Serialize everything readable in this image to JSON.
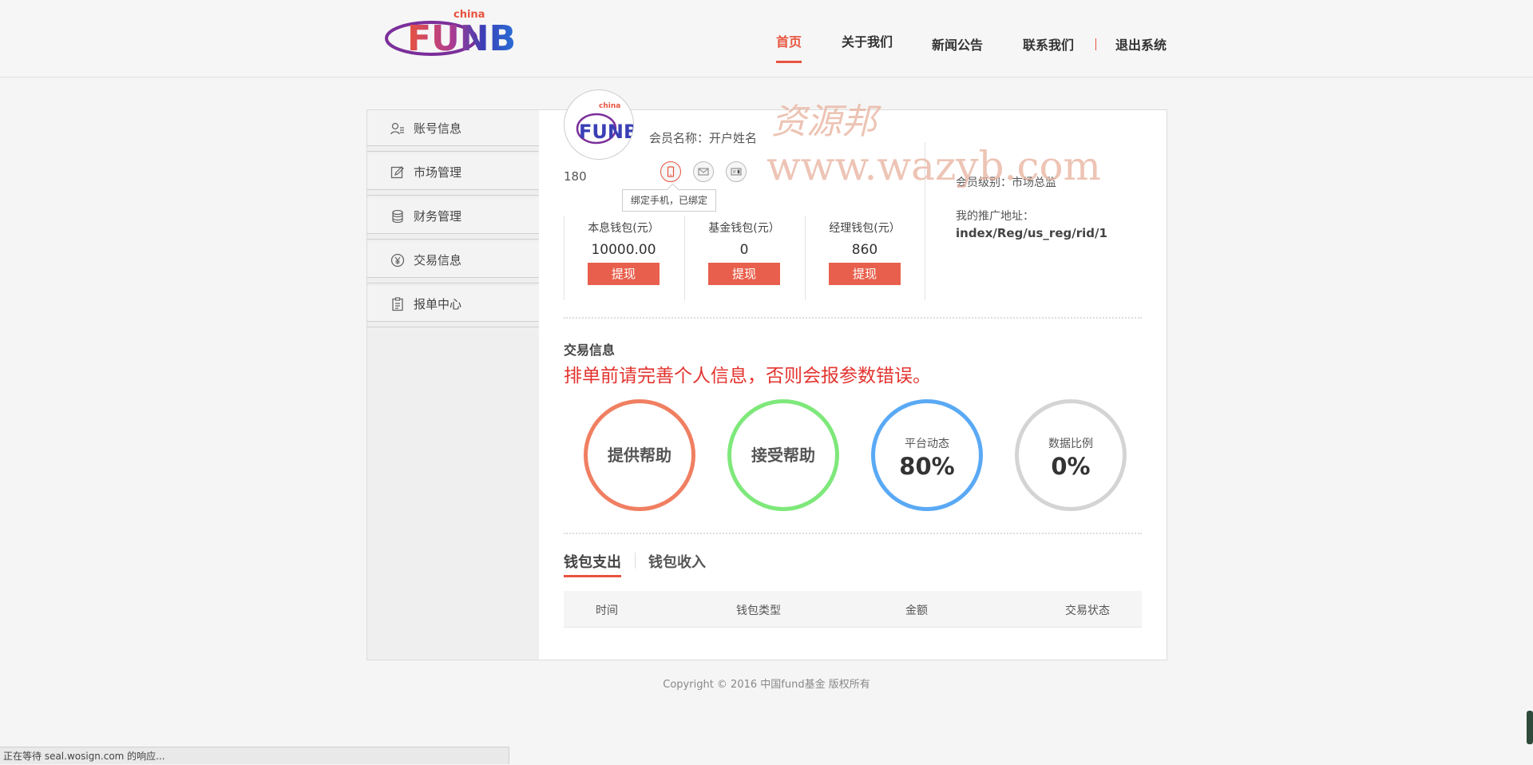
{
  "header": {
    "logo_text": "FUNB",
    "logo_sub": "china",
    "nav": [
      {
        "label": "首页",
        "active": true
      },
      {
        "label": "关于我们",
        "active": false
      },
      {
        "label": "新闻公告",
        "active": false
      },
      {
        "label": "联系我们",
        "active": false
      },
      {
        "label": "退出系统",
        "active": false
      }
    ]
  },
  "sidebar": {
    "items": [
      {
        "label": "账号信息",
        "icon": "user-card-icon"
      },
      {
        "label": "市场管理",
        "icon": "edit-icon"
      },
      {
        "label": "财务管理",
        "icon": "coins-icon"
      },
      {
        "label": "交易信息",
        "icon": "yen-icon"
      },
      {
        "label": "报单中心",
        "icon": "clipboard-icon"
      }
    ]
  },
  "profile": {
    "member_name": "会员名称：开户姓名",
    "member_id": "180",
    "bind_tooltip": "绑定手机，已绑定",
    "level": "会员级别：市场总监",
    "promo_label": "我的推广地址：",
    "promo_url": "index/Reg/us_reg/rid/1"
  },
  "wallets": [
    {
      "title": "本息钱包(元）",
      "value": "10000.00",
      "button": "提现"
    },
    {
      "title": "基金钱包(元）",
      "value": "0",
      "button": "提现"
    },
    {
      "title": "经理钱包(元）",
      "value": "860",
      "button": "提现"
    }
  ],
  "trade": {
    "title": "交易信息",
    "warning": "排单前请完善个人信息，否则会报参数错误。",
    "circles": [
      {
        "label": "提供帮助",
        "color": "#f07f62"
      },
      {
        "label": "接受帮助",
        "color": "#7ee87a"
      },
      {
        "label": "平台动态",
        "value": "80%",
        "percent": 80,
        "color": "#5aa9f5"
      },
      {
        "label": "数据比例",
        "value": "0%",
        "percent": 0,
        "color": "#d4d4d4"
      }
    ]
  },
  "wallet_tabs": {
    "tabs": [
      {
        "label": "钱包支出",
        "active": true
      },
      {
        "label": "钱包收入",
        "active": false
      }
    ],
    "columns": [
      "时间",
      "钱包类型",
      "金额",
      "交易状态"
    ]
  },
  "footer": {
    "copyright": "Copyright © 2016 中国fund基金 版权所有"
  },
  "status_bar": {
    "text": "正在等待 seal.wosign.com 的响应..."
  },
  "watermark": {
    "line1": "资源邦",
    "line2": "www.wazyb.com"
  },
  "colors": {
    "accent": "#e8533f",
    "button": "#e8604d",
    "warning": "#e3342f"
  }
}
